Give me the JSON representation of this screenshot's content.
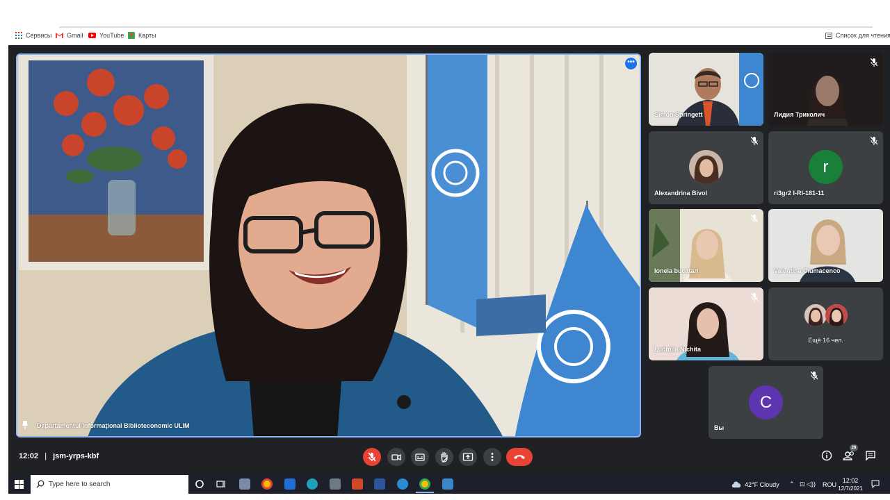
{
  "bookmarks": [
    {
      "label": "Сервисы",
      "icon": "apps-grid-icon"
    },
    {
      "label": "Gmail",
      "icon": "gmail-icon"
    },
    {
      "label": "YouTube",
      "icon": "youtube-icon"
    },
    {
      "label": "Карты",
      "icon": "maps-icon"
    }
  ],
  "reading_list": {
    "label": "Список для чтения",
    "icon": "reading-list-icon"
  },
  "main_speaker": {
    "name": "Departamentul Informaţional Biblioteconomic ULIM"
  },
  "participants": [
    {
      "name": "Simon Springett",
      "muted": false
    },
    {
      "name": "Лидия Триколич",
      "muted": true
    },
    {
      "name": "Alexandrina Bivol",
      "muted": true
    },
    {
      "name": "ri3gr2 I-RI-181-11",
      "muted": true,
      "avatar_letter": "r",
      "avatar_color": "#188038"
    },
    {
      "name": "Ionela bucatari",
      "muted": true
    },
    {
      "name": "Valentina Ciumacenco",
      "muted": false
    },
    {
      "name": "Ludmila Nichita",
      "muted": true
    },
    {
      "name": "Ещё 16 чел."
    },
    {
      "name": "Вы",
      "muted": true,
      "avatar_letter": "C",
      "avatar_color": "#5e35b1"
    }
  ],
  "meeting": {
    "time": "12:02",
    "code": "jsm-yrps-kbf",
    "participant_count": "26"
  },
  "taskbar": {
    "search_placeholder": "Type here to search",
    "weather": "42°F  Cloudy",
    "language": "ROU",
    "clock_time": "12:02",
    "clock_date": "12/7/2021"
  },
  "colors": {
    "meet_bg": "#202124",
    "tile_bg": "#3c4043",
    "accent_blue": "#8ab4f8",
    "end_call_red": "#ea4335"
  }
}
